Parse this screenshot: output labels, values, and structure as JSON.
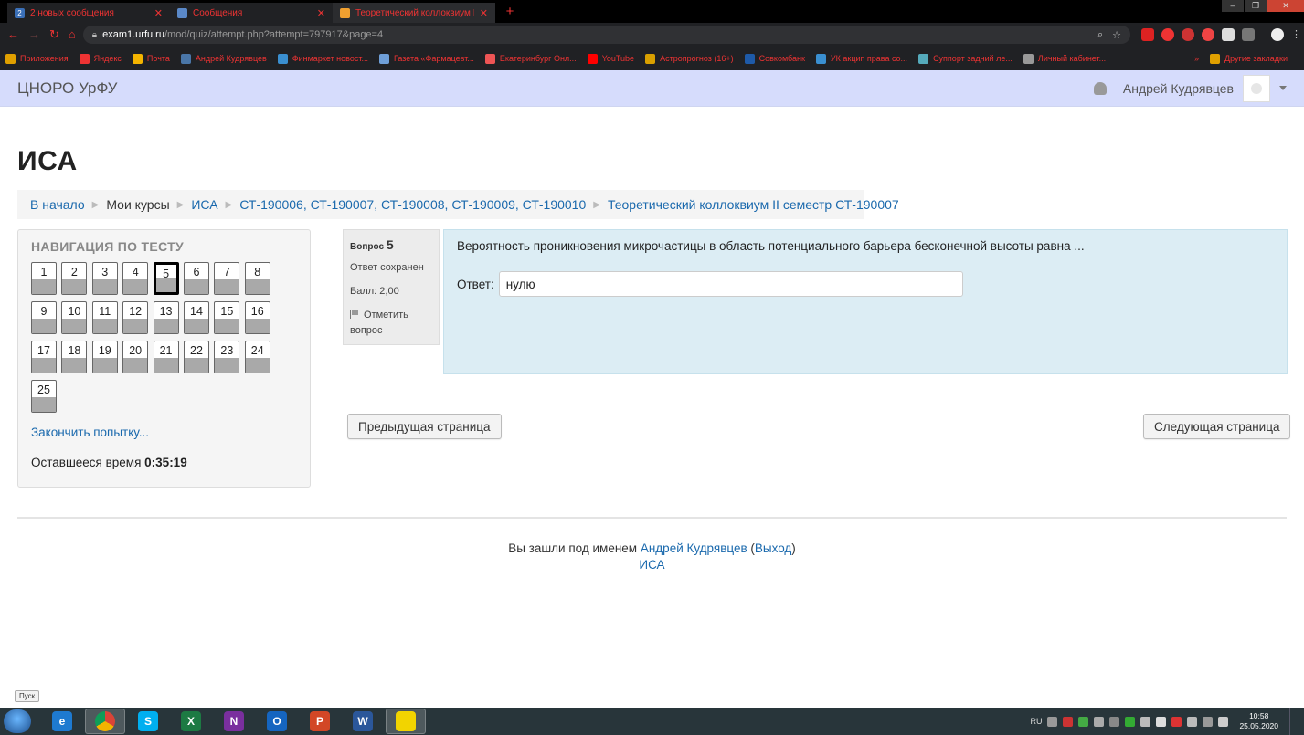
{
  "browser": {
    "tabs": [
      {
        "label": "2 новых сообщения",
        "badge": "2",
        "color": "#3a6fb7"
      },
      {
        "label": "Сообщения",
        "color": "#5a88c8"
      },
      {
        "label": "Теоретический коллоквиум II с",
        "color": "#f0a030"
      }
    ],
    "url_host": "exam1.urfu.ru",
    "url_path": "/mod/quiz/attempt.php?attempt=797917&page=4",
    "bookmarks": [
      {
        "label": "Приложения",
        "color": "#e0a000"
      },
      {
        "label": "Яндекс",
        "color": "#e33"
      },
      {
        "label": "Почта",
        "color": "#f4b400"
      },
      {
        "label": "Андрей Кудрявцев",
        "color": "#4a76a8"
      },
      {
        "label": "Финмаркет новост...",
        "color": "#3a8fd0"
      },
      {
        "label": "Газета «Фармацевт...",
        "color": "#6f9fd8"
      },
      {
        "label": "Екатеринбург Онл...",
        "color": "#e55"
      },
      {
        "label": "YouTube",
        "color": "#f00"
      },
      {
        "label": "Астропрогноз (16+)",
        "color": "#d9a000"
      },
      {
        "label": "Совкомбанк",
        "color": "#1e5aa8"
      },
      {
        "label": "УК акцип права со...",
        "color": "#3a8fd0"
      },
      {
        "label": "Суппорт задний ле...",
        "color": "#5ab"
      },
      {
        "label": "Личный кабинет...",
        "color": "#999"
      }
    ],
    "bookmarks_more": "»",
    "bookmarks_other": "Другие закладки"
  },
  "header": {
    "brand": "ЦНОРО УрФУ",
    "user_name": "Андрей Кудрявцев"
  },
  "page": {
    "title": "ИСА",
    "breadcrumb": [
      {
        "label": "В начало",
        "link": true
      },
      {
        "label": "Мои курсы",
        "link": false
      },
      {
        "label": "ИСА",
        "link": true
      },
      {
        "label": "СТ-190006, СТ-190007, СТ-190008, СТ-190009, СТ-190010",
        "link": true
      },
      {
        "label": "Теоретический коллоквиум II семестр СТ-190007",
        "link": true
      }
    ]
  },
  "quiz_nav": {
    "title": "НАВИГАЦИЯ ПО ТЕСТУ",
    "questions": [
      "1",
      "2",
      "3",
      "4",
      "5",
      "6",
      "7",
      "8",
      "9",
      "10",
      "11",
      "12",
      "13",
      "14",
      "15",
      "16",
      "17",
      "18",
      "19",
      "20",
      "21",
      "22",
      "23",
      "24",
      "25"
    ],
    "current": "5",
    "finish_label": "Закончить попытку...",
    "time_label": "Оставшееся время",
    "time_value": "0:35:19"
  },
  "question": {
    "label": "Вопрос",
    "number": "5",
    "status": "Ответ сохранен",
    "score": "Балл: 2,00",
    "flag_label": "Отметить вопрос",
    "text": "Вероятность проникновения микрочастицы в область потенциального барьера бесконечной высоты равна ...",
    "answer_label": "Ответ:",
    "answer_value": "нулю"
  },
  "buttons": {
    "prev": "Предыдущая страница",
    "next": "Следующая страница"
  },
  "footer": {
    "logged_in_prefix": "Вы зашли под именем",
    "user_name": "Андрей Кудрявцев",
    "logout": "Выход",
    "course_link": "ИСА"
  },
  "pusk": "Пуск",
  "taskbar": {
    "apps": [
      {
        "name": "ie-icon",
        "glyph": "e",
        "color": "#1e7ad0"
      },
      {
        "name": "chrome-icon",
        "glyph": "",
        "color": "#3c9a44",
        "active": true
      },
      {
        "name": "skype-icon",
        "glyph": "S",
        "color": "#00aff0"
      },
      {
        "name": "excel-icon",
        "glyph": "X",
        "color": "#1d7a43"
      },
      {
        "name": "onenote-icon",
        "glyph": "N",
        "color": "#7a2f9e"
      },
      {
        "name": "outlook-icon",
        "glyph": "O",
        "color": "#1565c0"
      },
      {
        "name": "powerpoint-icon",
        "glyph": "P",
        "color": "#d24726"
      },
      {
        "name": "word-icon",
        "glyph": "W",
        "color": "#2b579a"
      },
      {
        "name": "batman-icon",
        "glyph": "",
        "color": "#f2d400",
        "active": true
      }
    ],
    "lang": "RU",
    "time": "10:58",
    "date": "25.05.2020"
  }
}
